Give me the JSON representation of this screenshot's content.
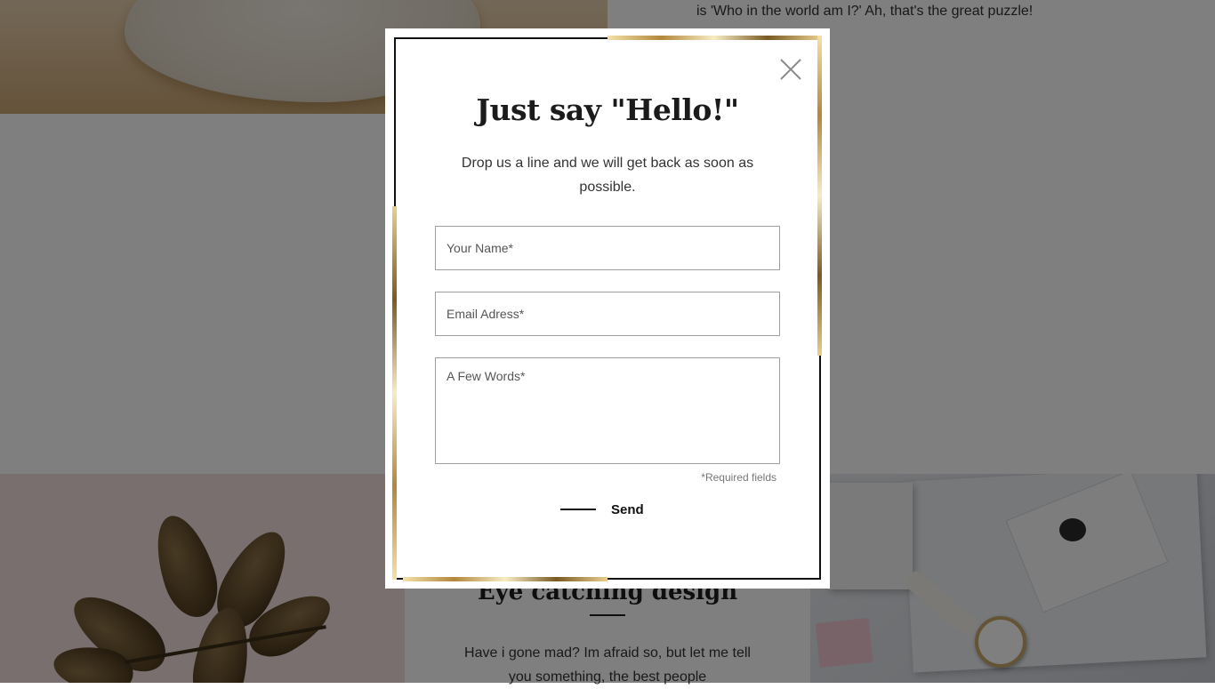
{
  "background": {
    "top_quote": "is 'Who in the world am I?' Ah, that's the great puzzle!",
    "section": {
      "title": "Eye catching design",
      "body": "Have i gone mad? Im afraid so, but let me tell you something, the best people"
    }
  },
  "modal": {
    "title": "Just say \"Hello!\"",
    "subtitle": "Drop us a line and we will get back as soon as possible.",
    "fields": {
      "name": "Your Name*",
      "email": "Email Adress*",
      "message": "A Few Words*"
    },
    "required_note": "*Required fields",
    "send_label": "Send",
    "close_icon": "close-icon"
  },
  "colors": {
    "overlay": "rgba(0,0,0,0.5)",
    "frame": "#111111",
    "accent_gold": "#b3873c"
  }
}
